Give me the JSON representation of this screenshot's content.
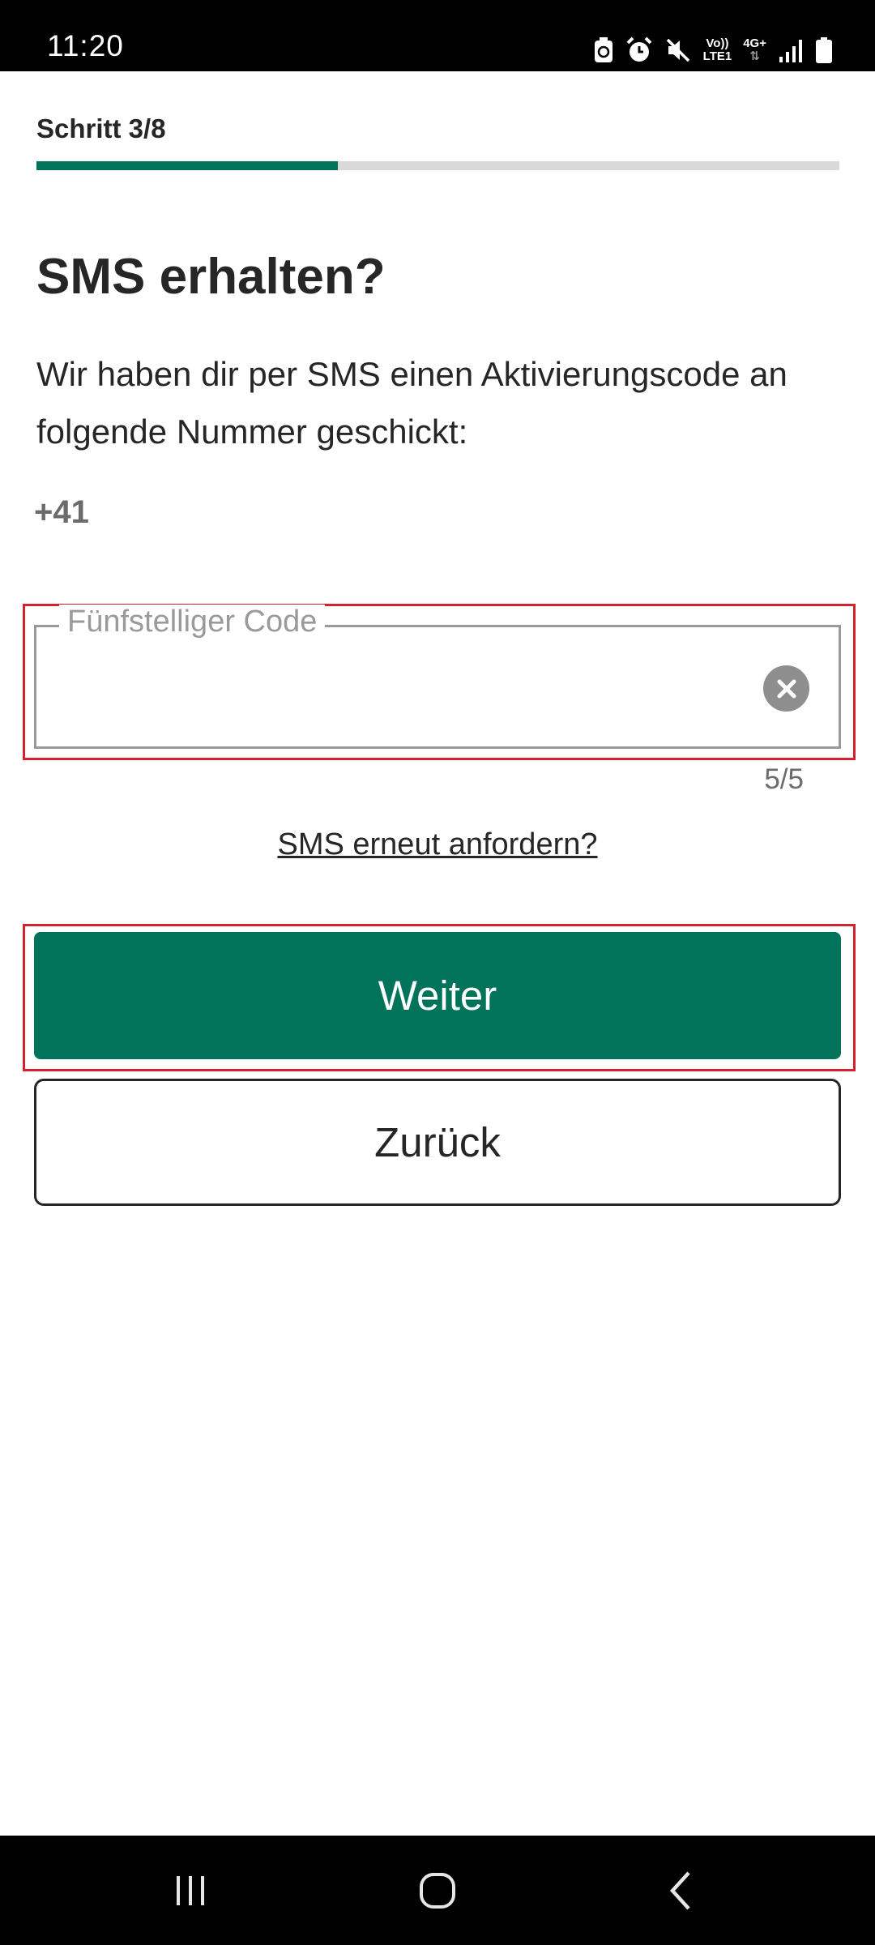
{
  "status_bar": {
    "time": "11:20",
    "icons": [
      "battery-saver-icon",
      "alarm-icon",
      "mute-icon",
      "volte-icon",
      "4g-plus-icon",
      "signal-icon",
      "battery-icon"
    ],
    "volte_text_top": "Vo))",
    "volte_text_bottom": "LTE1",
    "network_text": "4G+"
  },
  "header": {
    "step_label": "Schritt 3/8",
    "progress": 0.375,
    "accent_color": "#00735a"
  },
  "main": {
    "title": "SMS erhalten?",
    "description": "Wir haben dir per SMS einen Aktivierungscode an folgende Nummer geschickt:",
    "phone_number": "+41",
    "code_field": {
      "label": "Fünfstelliger Code",
      "value": "",
      "counter": "5/5"
    },
    "resend_link": "SMS erneut anfordern?"
  },
  "buttons": {
    "primary_label": "Weiter",
    "secondary_label": "Zurück"
  },
  "nav_bar": {
    "icons": [
      "recent-apps-icon",
      "home-icon",
      "back-icon"
    ]
  }
}
